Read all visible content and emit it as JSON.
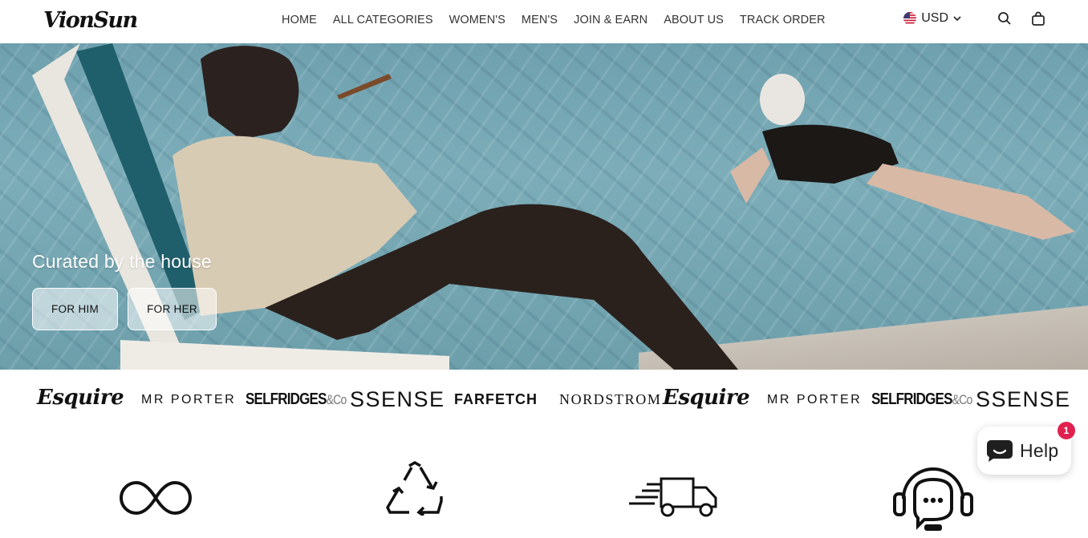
{
  "header": {
    "logo": "VionSun",
    "nav": [
      {
        "label": "HOME"
      },
      {
        "label": "ALL CATEGORIES"
      },
      {
        "label": "WOMEN'S"
      },
      {
        "label": "MEN'S"
      },
      {
        "label": "JOIN & EARN"
      },
      {
        "label": "ABOUT US"
      },
      {
        "label": "TRACK ORDER"
      }
    ],
    "currency": "USD",
    "icons": {
      "flag": "us-flag-icon",
      "chevron": "chevron-down-icon",
      "search": "search-icon",
      "cart": "shopping-bag-icon"
    }
  },
  "hero": {
    "caption": "Curated by the house",
    "buttons": [
      {
        "label": "FOR HIM"
      },
      {
        "label": "FOR HER"
      }
    ]
  },
  "press_logos": [
    {
      "name": "Esquire"
    },
    {
      "name": "MR PORTER"
    },
    {
      "name": "SELFRIDGES",
      "suffix": "&Co"
    },
    {
      "name": "SSENSE"
    },
    {
      "name": "FARFETCH"
    },
    {
      "name": "NORDSTROM"
    },
    {
      "name": "Esquire"
    },
    {
      "name": "MR PORTER"
    },
    {
      "name": "SELFRIDGES",
      "suffix": "&Co"
    },
    {
      "name": "SSENSE"
    }
  ],
  "features": [
    {
      "icon": "infinity-icon"
    },
    {
      "icon": "recycle-icon"
    },
    {
      "icon": "delivery-truck-icon"
    },
    {
      "icon": "customer-support-icon"
    }
  ],
  "help_widget": {
    "label": "Help",
    "badge": "1",
    "badge_color": "#e0214f"
  }
}
